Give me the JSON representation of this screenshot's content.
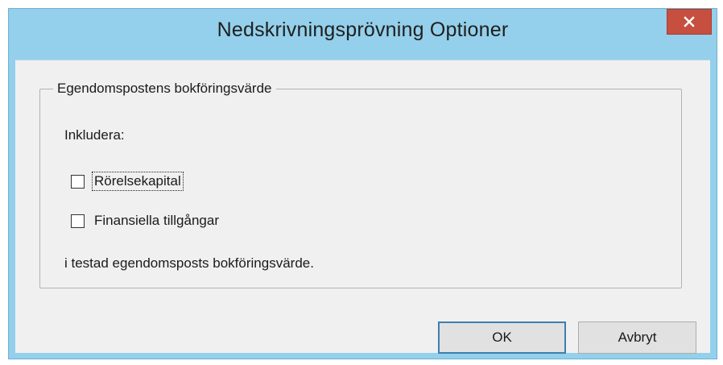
{
  "window": {
    "title": "Nedskrivningsprövning Optioner",
    "close_symbol": "×"
  },
  "group": {
    "legend": "Egendomspostens bokföringsvärde",
    "include_label": "Inkludera:",
    "options": [
      {
        "label": "Rörelsekapital",
        "checked": false,
        "focused": true
      },
      {
        "label": "Finansiella tillgångar",
        "checked": false,
        "focused": false
      }
    ],
    "footer_text": "i testad egendomsposts bokföringsvärde."
  },
  "buttons": {
    "ok_label": "OK",
    "cancel_label": "Avbryt"
  },
  "colors": {
    "title_bar": "#94d0eb",
    "close_button": "#c74f3f",
    "client_background": "#f0f0f0",
    "default_button_border": "#3c7fb1"
  },
  "icons": {
    "close": "close-icon"
  }
}
